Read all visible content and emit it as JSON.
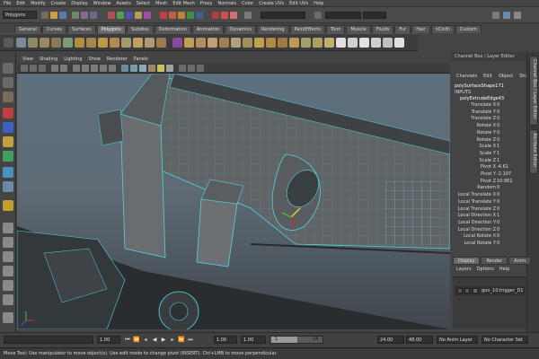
{
  "menubar": [
    "File",
    "Edit",
    "Modify",
    "Create",
    "Display",
    "Window",
    "Assets",
    "Select",
    "Mesh",
    "Edit Mesh",
    "Proxy",
    "Normals",
    "Color",
    "Create UVs",
    "Edit UVs",
    "Help"
  ],
  "status": {
    "mode": "Polygons"
  },
  "shelf_tabs": [
    "General",
    "Curves",
    "Surfaces",
    "Polygons",
    "Subdivs",
    "Deformation",
    "Animation",
    "Dynamics",
    "Rendering",
    "PaintEffects",
    "Toon",
    "Muscle",
    "Fluids",
    "Fur",
    "Hair",
    "nCloth",
    "Custom"
  ],
  "shelf_active": "Polygons",
  "panel_menu": [
    "View",
    "Shading",
    "Lighting",
    "Show",
    "Renderer",
    "Panels"
  ],
  "channel_box": {
    "header": "Channel Box / Layer Editor",
    "menu": [
      "Channels",
      "Edit",
      "Object",
      "Show"
    ],
    "shape": "polySurfaceShape171",
    "inputs": "INPUTS",
    "node": "polyExtrudeEdge43",
    "attrs": [
      {
        "name": "Translate X",
        "value": "0"
      },
      {
        "name": "Translate Y",
        "value": "0"
      },
      {
        "name": "Translate Z",
        "value": "0"
      },
      {
        "name": "Rotate X",
        "value": "0"
      },
      {
        "name": "Rotate Y",
        "value": "0"
      },
      {
        "name": "Rotate Z",
        "value": "0"
      },
      {
        "name": "Scale X",
        "value": "1"
      },
      {
        "name": "Scale Y",
        "value": "1"
      },
      {
        "name": "Scale Z",
        "value": "1"
      },
      {
        "name": "Pivot X",
        "value": "-4.61"
      },
      {
        "name": "Pivot Y",
        "value": "-2.107"
      },
      {
        "name": "Pivot Z",
        "value": "10.861"
      },
      {
        "name": "Random",
        "value": "0"
      },
      {
        "name": "Local Translate X",
        "value": "0"
      },
      {
        "name": "Local Translate Y",
        "value": "0"
      },
      {
        "name": "Local Translate Z",
        "value": "0"
      },
      {
        "name": "Local Direction X",
        "value": "1"
      },
      {
        "name": "Local Direction Y",
        "value": "0"
      },
      {
        "name": "Local Direction Z",
        "value": "0"
      },
      {
        "name": "Local Rotate X",
        "value": "0"
      },
      {
        "name": "Local Rotate Y",
        "value": "0"
      }
    ]
  },
  "side_tabs": [
    "Channel Box / Layer Editor",
    "Attribute Editor"
  ],
  "layer_editor": {
    "tabs": [
      "Display",
      "Render",
      "Anim"
    ],
    "menu": [
      "Layers",
      "Options",
      "Help"
    ],
    "layer_name": "gun_10:trigger_D1"
  },
  "timebar": {
    "start": "1.00",
    "current": "1.00",
    "range_start": "1.00",
    "range_frame": "1",
    "range_end_frame": "24",
    "end": "24.00",
    "max": "48.00",
    "anim_layer": "No Anim Layer",
    "char_set": "No Character Set",
    "range_fraction": 0.5
  },
  "help_line": "Move Tool: Use manipulator to move object(s). Use edit mode to change pivot (INSERT). Ctrl+LMB to move perpendicular.",
  "colors": {
    "accent": "#4fd6e0",
    "wire": "#39c4cf",
    "bg": "#444444"
  }
}
